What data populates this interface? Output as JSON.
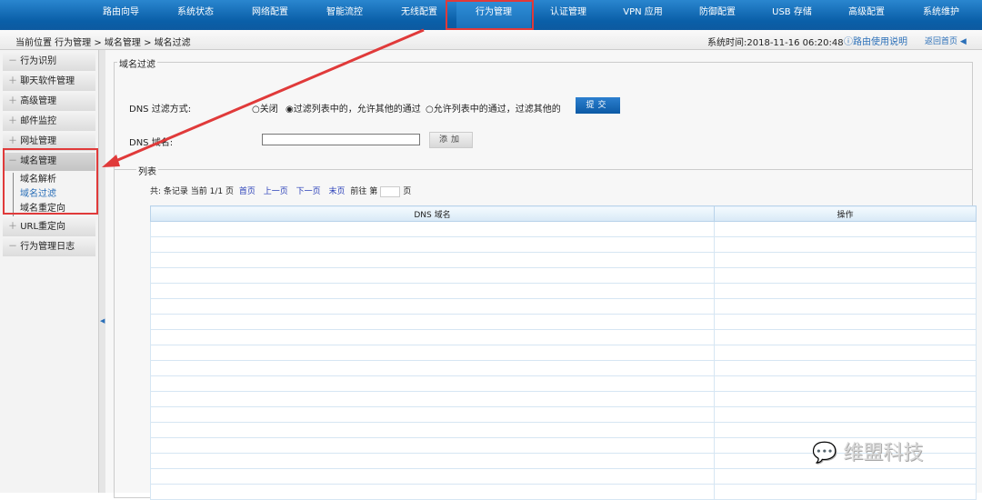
{
  "nav": [
    "路由向导",
    "系统状态",
    "网络配置",
    "智能流控",
    "无线配置",
    "行为管理",
    "认证管理",
    "VPN 应用",
    "防御配置",
    "USB 存储",
    "高级配置",
    "系统维护"
  ],
  "bar": {
    "breadcrumb": "当前位置 行为管理 > 域名管理 > 域名过滤",
    "system_time": "系统时间:2018-11-16 06:20:48",
    "help": "路由使用说明",
    "home": "返回首页"
  },
  "sidebar": {
    "groups": [
      {
        "icon": "－",
        "label": "行为识别"
      },
      {
        "icon": "＋",
        "label": "聊天软件管理"
      },
      {
        "icon": "＋",
        "label": "高级管理"
      },
      {
        "icon": "＋",
        "label": "邮件监控"
      },
      {
        "icon": "＋",
        "label": "网址管理"
      },
      {
        "icon": "－",
        "label": "域名管理"
      }
    ],
    "subitems": [
      "域名解析",
      "域名过滤",
      "域名重定向"
    ],
    "groups2": [
      {
        "icon": "＋",
        "label": "URL重定向"
      },
      {
        "icon": "－",
        "label": "行为管理日志"
      }
    ]
  },
  "form": {
    "legend": "域名过滤",
    "mode_label": "DNS 过滤方式:",
    "options": [
      "关闭",
      "过滤列表中的，允许其他的通过",
      "允许列表中的通过，过滤其他的"
    ],
    "selected": 1,
    "submit": "提交",
    "domain_label": "DNS 域名:",
    "domain_value": "",
    "add": "添加"
  },
  "list": {
    "legend": "列表",
    "pager": {
      "summary": "共: 条记录 当前 1/1 页",
      "first": "首页",
      "prev": "上一页",
      "next": "下一页",
      "last": "末页",
      "goto": "前往 第",
      "page_unit": "页"
    },
    "columns": [
      "DNS 域名",
      "操作"
    ]
  },
  "watermark": "维盟科技"
}
